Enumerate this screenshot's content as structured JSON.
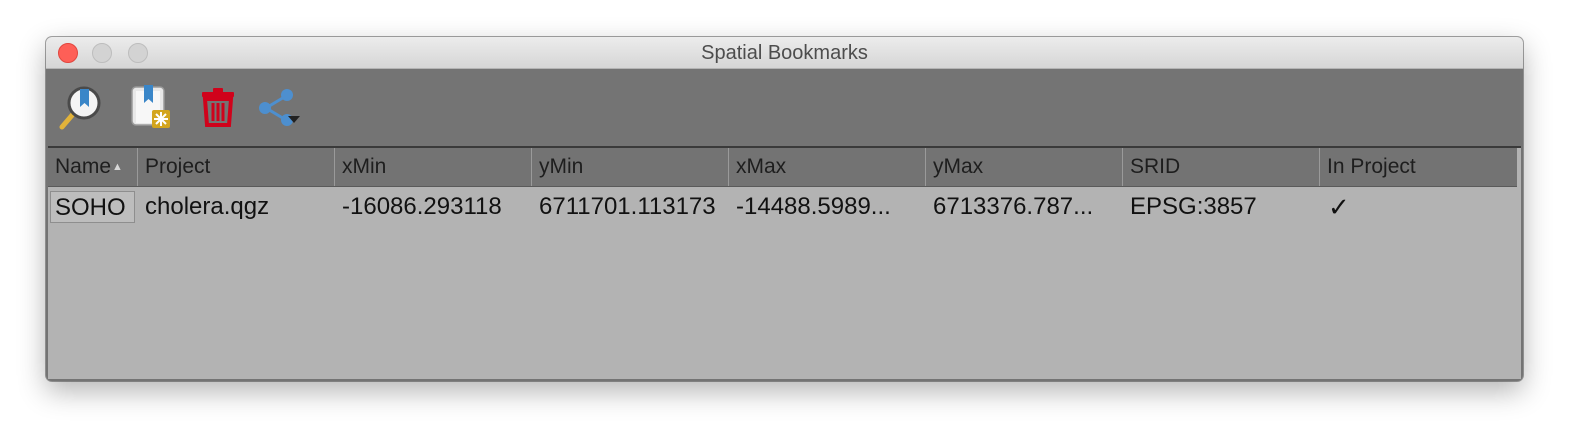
{
  "window": {
    "title": "Spatial Bookmarks"
  },
  "toolbar": {
    "buttons": [
      {
        "icon": "zoom-to-bookmark-icon"
      },
      {
        "icon": "new-bookmark-icon"
      },
      {
        "icon": "delete-bookmark-icon"
      },
      {
        "icon": "share-icon"
      }
    ]
  },
  "table": {
    "columns": [
      "Name",
      "Project",
      "xMin",
      "yMin",
      "xMax",
      "yMax",
      "SRID",
      "In Project"
    ],
    "sort_indicator": "▲",
    "rows": [
      {
        "name": "SOHO",
        "project": "cholera.qgz",
        "xmin": "-16086.293118",
        "ymin": "6711701.113173",
        "xmax": "-14488.5989...",
        "ymax": "6713376.787...",
        "srid": "EPSG:3857",
        "in_project": "✓"
      }
    ]
  },
  "colors": {
    "close_button": "#fe5f57",
    "delete_icon": "#d0021b",
    "toolbar_bg": "#747474",
    "table_bg": "#b3b3b3"
  }
}
